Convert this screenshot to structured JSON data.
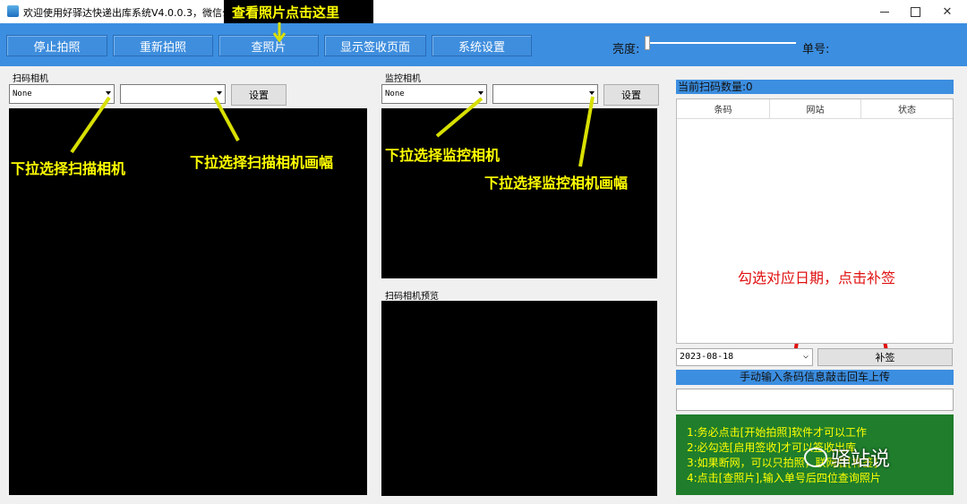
{
  "window": {
    "title": "欢迎使用好驿达快递出库系统V4.0.0.3，微信公众号"
  },
  "toolbar": {
    "stop_label": "停止拍照",
    "retake_label": "重新拍照",
    "view_photo_label": "查照片",
    "show_sign_label": "显示签收页面",
    "settings_label": "系统设置",
    "brightness_label": "亮度:",
    "order_label": "单号:"
  },
  "scan_camera": {
    "section_label": "扫码相机",
    "camera_value": "None",
    "resolution_value": "",
    "settings_label": "设置"
  },
  "monitor_camera": {
    "section_label": "监控相机",
    "camera_value": "None",
    "resolution_value": "",
    "settings_label": "设置"
  },
  "preview": {
    "section_label": "扫码相机预览"
  },
  "right_panel": {
    "count_label": "当前扫码数量:0",
    "columns": [
      "条码",
      "网站",
      "状态"
    ],
    "date_value": "2023-08-18",
    "resign_label": "补签",
    "manual_label": "手动输入条码信息敲击回车上传",
    "manual_value": "",
    "tips": [
      "1:务必点击[开始拍照]软件才可以工作",
      "2:必勾选[启用签收]才可以签收出库",
      "3:如果断网，可以只拍照，联网后[补签]",
      "4:点击[查照片],输入单号后四位查询照片"
    ]
  },
  "annotations": {
    "view_photo": "查看照片点击这里",
    "scan_camera_select": "下拉选择扫描相机",
    "scan_resolution_select": "下拉选择扫描相机画幅",
    "monitor_camera_select": "下拉选择监控相机",
    "monitor_resolution_select": "下拉选择监控相机画幅",
    "resign_hint": "勾选对应日期，点击补签"
  },
  "watermark": {
    "text": "驿站说"
  }
}
